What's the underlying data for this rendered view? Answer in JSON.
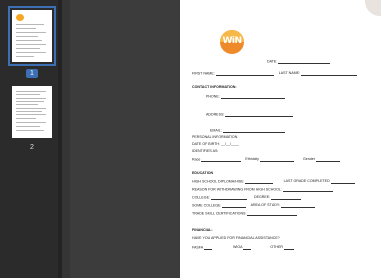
{
  "sidebar": {
    "pages": [
      {
        "number": "1"
      },
      {
        "number": "2"
      }
    ]
  },
  "logo": {
    "text": "WiN"
  },
  "form": {
    "date_label": "DATE:",
    "first_name_label": "FIRST NAME:",
    "last_name_label": "LAST NAME:",
    "contact_heading": "CONTACT INFORMATION:",
    "phone_label": "PHONE:",
    "address_label": "ADDRESS:",
    "email_label": "EMAIL:",
    "personal_label": "PERSONAL INFORMATION",
    "dob_label": "DATE OF BIRTH:",
    "dob_value": "__/__/____",
    "identifies_label": "IDENTIFIES AS:",
    "race_label": "Race",
    "ethnicity_label": "Ethnicity",
    "gender_label": "Gender",
    "education_heading": "EDUCATION",
    "hs_diploma_label": "HIGH SCHOOL DIPLOMA/HISE",
    "last_grade_label": "LAST GRADE COMPLETED",
    "withdraw_label": "REASON FOR WITHDRAWING FROM HIGH SCHOOL:",
    "college_label": "COLLEGE:",
    "degree_label": "DEGREE:",
    "some_college_label": "SOME COLLEGE",
    "area_label": "AREA OF STUDY:",
    "trade_label": "TRADE SKILL CERTIFICATIONS:",
    "financial_heading": "FINANCIAL:",
    "fin_question": "HAVE YOU APPLIED FOR FINANCIAL ASSISTANCE?",
    "fafsa_label": "FASFA",
    "wioa_label": "WIOA",
    "other_label": "OTHER"
  }
}
